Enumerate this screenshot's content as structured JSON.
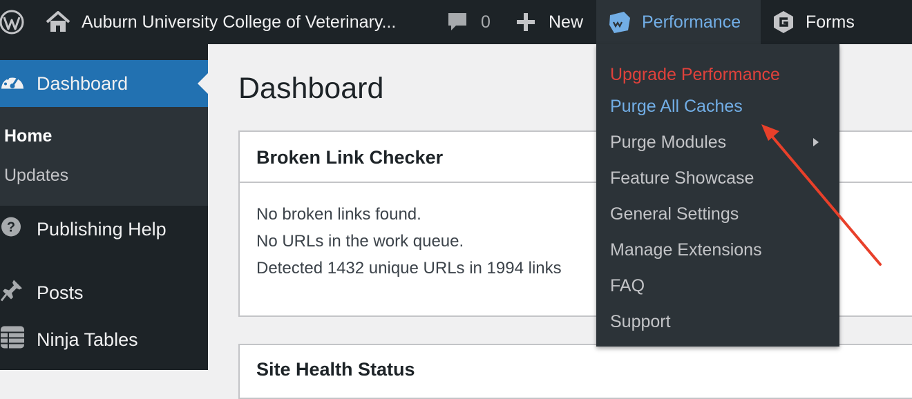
{
  "admin_bar": {
    "wp_logo_icon": "wordpress-logo-icon",
    "site": {
      "icon": "home-icon",
      "label": "Auburn University College of Veterinary..."
    },
    "comments": {
      "icon": "comment-bubble-icon",
      "count": "0"
    },
    "new": {
      "icon": "plus-icon",
      "label": "New"
    },
    "performance": {
      "icon": "w3-performance-icon",
      "label": "Performance"
    },
    "forms": {
      "icon": "gravity-forms-icon",
      "label": "Forms"
    }
  },
  "sidebar": {
    "dashboard": {
      "icon": "dashboard-gauge-icon",
      "label": "Dashboard"
    },
    "submenu": [
      "Home",
      "Updates"
    ],
    "items": [
      {
        "icon": "help-icon",
        "label": "Publishing Help"
      },
      {
        "icon": "pushpin-icon",
        "label": "Posts"
      },
      {
        "icon": "table-icon",
        "label": "Ninja Tables"
      }
    ]
  },
  "main": {
    "page_title": "Dashboard",
    "broken_link_checker": {
      "title": "Broken Link Checker",
      "lines": [
        "No broken links found.",
        "No URLs in the work queue.",
        "Detected 1432 unique URLs in 1994 links"
      ]
    },
    "site_health": {
      "title": "Site Health Status"
    }
  },
  "performance_menu": {
    "items": [
      "Upgrade Performance",
      "Purge All Caches",
      "Purge Modules",
      "Feature Showcase",
      "General Settings",
      "Manage Extensions",
      "FAQ",
      "Support"
    ],
    "submenu_caret_icon": "caret-right-icon"
  },
  "colors": {
    "admin_bar_bg": "#1d2327",
    "menu_active": "#2271b1",
    "upgrade_red": "#e0413b",
    "link_blue": "#72aee6",
    "annotation_arrow": "#e8402a"
  }
}
